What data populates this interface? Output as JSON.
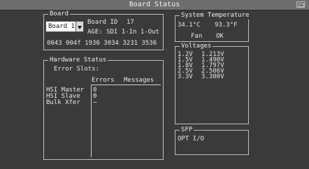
{
  "window": {
    "title": "Board Status"
  },
  "board": {
    "legend": "Board",
    "selector_value": "Board 1",
    "id_label": "Board ID",
    "id_value": "17",
    "age_text": "AGE: SDI 1-In 1-Out",
    "serial": "0043 004f 1936 3034 3231 3536"
  },
  "hardware": {
    "legend": "Hardware Status",
    "error_slots": "Error Slots:",
    "col_errors": "Errors",
    "col_messages": "Messages",
    "rows": [
      {
        "label": "HSI Master",
        "errors": "0"
      },
      {
        "label": "HSI Slave",
        "errors": "0"
      },
      {
        "label": "Bulk Xfer",
        "errors": "—"
      }
    ]
  },
  "temperature": {
    "legend": "System Temperature",
    "celsius": "34.1°C",
    "fahrenheit": "93.3°F",
    "fan_label": "Fan",
    "fan_value": "OK"
  },
  "voltages": {
    "legend": "Voltages",
    "rows": [
      {
        "nominal": "1.2V",
        "actual": "1.213V"
      },
      {
        "nominal": "1.5V",
        "actual": "1.490V"
      },
      {
        "nominal": "1.8V",
        "actual": "1.797V"
      },
      {
        "nominal": "2.5V",
        "actual": "2.506V"
      },
      {
        "nominal": "3.3V",
        "actual": "3.300V"
      }
    ]
  },
  "sfp": {
    "legend": "SFP",
    "text": "OPT I/O"
  }
}
